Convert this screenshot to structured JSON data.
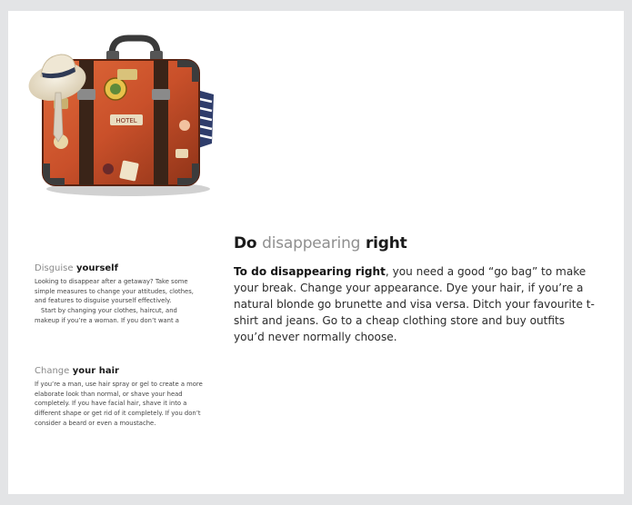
{
  "article": {
    "title_muted_prefix": "Do",
    "title_muted_word": "disappearing",
    "title_bold": "right",
    "lead": "To do disappearing right",
    "body": ", you need a good “go bag” to make your break. Change your appearance. Dye your hair, if you’re a natural blonde go brunette and visa versa. Ditch your favourite t-shirt and jeans. Go to a cheap clothing store and buy outfits you’d never normally choose."
  },
  "sidebar": {
    "sections": [
      {
        "title_light": "Disguise",
        "title_bold": "yourself",
        "para1": "Looking to disappear after a getaway? Take some simple measures to change your attitudes, clothes, and features to disguise yourself effectively.",
        "para2": "Start by changing your clothes, haircut, and makeup if you’re a woman. If you don’t want a"
      },
      {
        "title_light": "Change",
        "title_bold": "your hair",
        "para1": "If you’re a man, use hair spray or gel to create a more elaborate look than normal, or shave your head completely. If you have facial hair, shave it into a different shape or get rid of it completely. If you don’t consider a beard or even a moustache."
      }
    ]
  },
  "illustration": {
    "subject": "vintage-suitcase-with-hat"
  }
}
